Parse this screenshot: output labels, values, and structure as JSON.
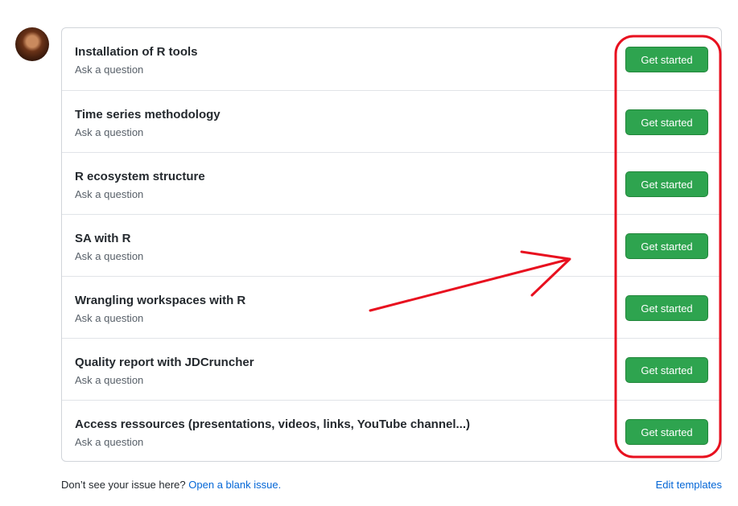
{
  "templates": [
    {
      "title": "Installation of R tools",
      "subtitle": "Ask a question",
      "button": "Get started"
    },
    {
      "title": "Time series methodology",
      "subtitle": "Ask a question",
      "button": "Get started"
    },
    {
      "title": "R ecosystem structure",
      "subtitle": "Ask a question",
      "button": "Get started"
    },
    {
      "title": "SA with R",
      "subtitle": "Ask a question",
      "button": "Get started"
    },
    {
      "title": "Wrangling workspaces with R",
      "subtitle": "Ask a question",
      "button": "Get started"
    },
    {
      "title": "Quality report with JDCruncher",
      "subtitle": "Ask a question",
      "button": "Get started"
    },
    {
      "title": "Access ressources (presentations, videos, links, YouTube channel...)",
      "subtitle": "Ask a question",
      "button": "Get started"
    }
  ],
  "footer": {
    "prompt": "Don’t see your issue here?",
    "blank_issue_link": "Open a blank issue.",
    "edit_templates_link": "Edit templates"
  },
  "colors": {
    "button_bg": "#2ea44f",
    "link": "#0366d6",
    "annotation_red": "#e8101f"
  },
  "icons": {
    "avatar": "user-avatar"
  }
}
